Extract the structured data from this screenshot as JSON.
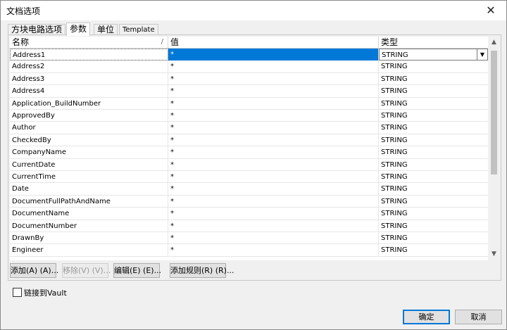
{
  "window": {
    "title": "文档选项",
    "close_glyph": "✕"
  },
  "tabs": [
    {
      "label": "方块电路选项",
      "active": false
    },
    {
      "label": "参数",
      "active": true
    },
    {
      "label": "单位",
      "active": false
    },
    {
      "label": "Template",
      "active": false
    }
  ],
  "grid": {
    "columns": {
      "name": "名称",
      "value": "值",
      "type": "类型"
    },
    "sort_glyph": "/",
    "rows": [
      {
        "name": "Address1",
        "value": "*",
        "type": "STRING"
      },
      {
        "name": "Address2",
        "value": "*",
        "type": "STRING"
      },
      {
        "name": "Address3",
        "value": "*",
        "type": "STRING"
      },
      {
        "name": "Address4",
        "value": "*",
        "type": "STRING"
      },
      {
        "name": "Application_BuildNumber",
        "value": "*",
        "type": "STRING"
      },
      {
        "name": "ApprovedBy",
        "value": "*",
        "type": "STRING"
      },
      {
        "name": "Author",
        "value": "*",
        "type": "STRING"
      },
      {
        "name": "CheckedBy",
        "value": "*",
        "type": "STRING"
      },
      {
        "name": "CompanyName",
        "value": "*",
        "type": "STRING"
      },
      {
        "name": "CurrentDate",
        "value": "*",
        "type": "STRING"
      },
      {
        "name": "CurrentTime",
        "value": "*",
        "type": "STRING"
      },
      {
        "name": "Date",
        "value": "*",
        "type": "STRING"
      },
      {
        "name": "DocumentFullPathAndName",
        "value": "*",
        "type": "STRING"
      },
      {
        "name": "DocumentName",
        "value": "*",
        "type": "STRING"
      },
      {
        "name": "DocumentNumber",
        "value": "*",
        "type": "STRING"
      },
      {
        "name": "DrawnBy",
        "value": "*",
        "type": "STRING"
      },
      {
        "name": "Engineer",
        "value": "*",
        "type": "STRING"
      }
    ],
    "scroll_up_glyph": "▲",
    "scroll_down_glyph": "▼",
    "dropdown_glyph": "▼"
  },
  "buttons": {
    "add": "添加(A) (A)...",
    "remove": "移除(V) (V)...",
    "edit": "编辑(E) (E)...",
    "add_rule": "添加规则(R) (R)...",
    "ok": "确定",
    "cancel": "取消"
  },
  "vault_link": {
    "label": "链接到Vault",
    "checked": false
  },
  "colors": {
    "selection": "#0078d7",
    "accent_border": "#0078d7"
  }
}
